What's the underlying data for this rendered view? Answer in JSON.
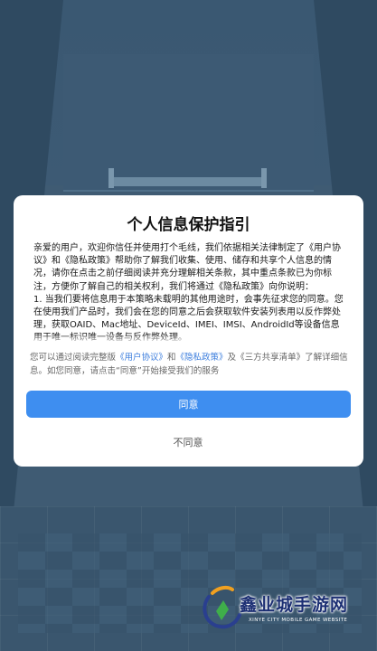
{
  "dialog": {
    "title": "个人信息保护指引",
    "body_paragraphs": [
      "亲爱的用户，欢迎你信任并使用打个毛线，我们依据相关法律制定了《用户协议》和《隐私政策》帮助你了解我们收集、使用、储存和共享个人信息的情况，请你在点击之前仔细阅读并充分理解相关条款，其中重点条款已为你标注，方便你了解自己的相关权利，我们将通过《隐私政策》向你说明：",
      "1. 当我们要将信息用于本策略未载明的其他用途时，会事先征求您的同意。您在使用我们产品时，我们会在您的同意之后会获取软件安装列表用以反作弊处理，获取OAID、Mac地址、DeviceId、IMEI、IMSI、AndroidId等设备信息用于唯一标识唯一设备与反作弊处理。"
    ],
    "notice": {
      "prefix": "您可以通过阅读完整版",
      "link_user_agreement": "《用户协议》",
      "and": "和",
      "link_privacy_policy": "《隐私政策》",
      "and2": "及",
      "third_party_list": "《三方共享清单》",
      "suffix": "了解详细信息。如您同意，请点击“同意”开始接受我们的服务"
    },
    "agree_label": "同意",
    "disagree_label": "不同意"
  },
  "watermark": {
    "title": "鑫业城手游网",
    "subtitle": "XINYE CITY MOBILE GAME WEBSITE"
  },
  "colors": {
    "accent": "#3e8ef0",
    "link": "#3b7ddd",
    "background": "#3f5b73"
  }
}
